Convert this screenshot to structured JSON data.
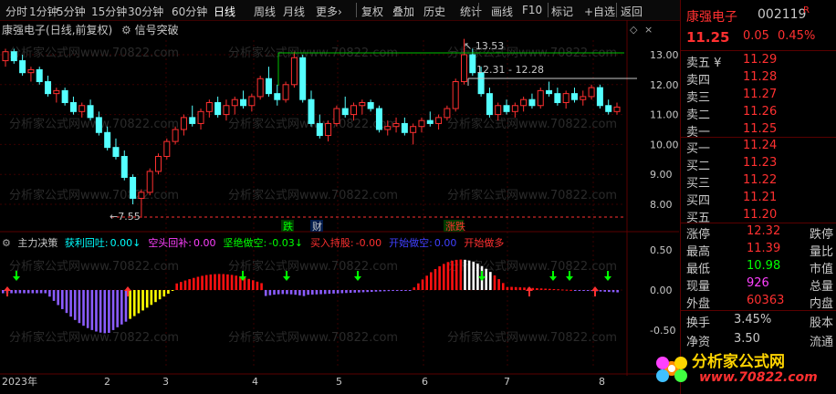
{
  "toolbar": {
    "items": [
      "分时",
      "1分钟",
      "5分钟",
      "15分钟",
      "30分钟",
      "60分钟",
      "日线",
      "周线",
      "月线",
      "更多›",
      "复权",
      "叠加",
      "历史",
      "统计",
      "画线",
      "F10",
      "标记",
      "+自选",
      "返回"
    ],
    "active": "日线"
  },
  "title": {
    "stock": "康强电子",
    "mode": "(日线,前复权)",
    "indicator": "信号突破"
  },
  "main_chart": {
    "y_ticks": [
      "13.00",
      "12.00",
      "11.00",
      "10.00",
      "9.00",
      "8.00"
    ],
    "high_label": "13.53",
    "low_label": "7.55",
    "range_label": "12.31 - 12.28",
    "annotations": [
      "跌",
      "财",
      "涨跌"
    ],
    "watermark": "分析家公式网www.70822.com"
  },
  "indicator": {
    "name": "主力决策",
    "items": [
      {
        "label": "获利回吐:",
        "value": "0.00↓",
        "color": "#00ffff"
      },
      {
        "label": "空头回补:",
        "value": "0.00",
        "color": "#ff40ff"
      },
      {
        "label": "坚绝做空:",
        "value": "-0.03↓",
        "color": "#00ff00"
      },
      {
        "label": "买入持股:",
        "value": "-0.00",
        "color": "#ff3030"
      },
      {
        "label": "开始做空:",
        "value": "0.00",
        "color": "#4040ff"
      },
      {
        "label": "开始做多",
        "value": "",
        "color": "#ff3030"
      }
    ],
    "y_ticks": [
      "0.50",
      "0.00",
      "-0.50"
    ]
  },
  "x_axis": {
    "labels": [
      "2023年",
      "2",
      "3",
      "4",
      "5",
      "6",
      "7",
      "8"
    ]
  },
  "quote": {
    "name": "康强电子",
    "code": "002119",
    "flag": "R",
    "price": "11.25",
    "change": "0.05",
    "pct": "0.45%",
    "asks": [
      {
        "label": "卖五 ¥",
        "price": "11.29"
      },
      {
        "label": "卖四",
        "price": "11.28"
      },
      {
        "label": "卖三",
        "price": "11.27"
      },
      {
        "label": "卖二",
        "price": "11.26"
      },
      {
        "label": "卖一",
        "price": "11.25"
      }
    ],
    "bids": [
      {
        "label": "买一",
        "price": "11.24"
      },
      {
        "label": "买二",
        "price": "11.23"
      },
      {
        "label": "买三",
        "price": "11.22"
      },
      {
        "label": "买四",
        "price": "11.21"
      },
      {
        "label": "买五",
        "price": "11.20"
      }
    ],
    "stats": [
      {
        "label": "涨停",
        "value": "12.32",
        "color": "#ff3030",
        "right": "跌停"
      },
      {
        "label": "最高",
        "value": "11.39",
        "color": "#ff3030",
        "right": "量比"
      },
      {
        "label": "最低",
        "value": "10.98",
        "color": "#00ff00",
        "right": "市值"
      },
      {
        "label": "现量",
        "value": "926",
        "color": "#ff40ff",
        "right": "总量"
      },
      {
        "label": "外盘",
        "value": "60363",
        "color": "#ff3030",
        "right": "内盘"
      },
      {
        "label": "换手",
        "value": "3.45%",
        "color": "#c8c8c8",
        "right": "股本"
      },
      {
        "label": "净资",
        "value": "3.50",
        "color": "#c8c8c8",
        "right": "流通"
      }
    ]
  },
  "logo": {
    "text": "分析家公式网",
    "url": "www.70822.com"
  },
  "candles": [
    [
      12.8,
      13.2,
      12.6,
      13.1
    ],
    [
      13.1,
      13.2,
      12.7,
      12.8
    ],
    [
      12.8,
      13.0,
      12.3,
      12.4
    ],
    [
      12.4,
      12.6,
      12.1,
      12.5
    ],
    [
      12.5,
      12.6,
      12.0,
      12.1
    ],
    [
      12.1,
      12.3,
      11.6,
      11.7
    ],
    [
      11.7,
      11.9,
      11.4,
      11.8
    ],
    [
      11.8,
      11.9,
      11.3,
      11.4
    ],
    [
      11.4,
      11.6,
      11.0,
      11.1
    ],
    [
      11.1,
      11.4,
      10.9,
      11.3
    ],
    [
      11.3,
      11.5,
      10.8,
      10.9
    ],
    [
      10.9,
      11.1,
      10.3,
      10.4
    ],
    [
      10.4,
      10.6,
      9.8,
      9.9
    ],
    [
      9.9,
      10.2,
      9.5,
      9.6
    ],
    [
      9.6,
      9.8,
      8.8,
      8.9
    ],
    [
      8.9,
      9.0,
      8.0,
      8.2
    ],
    [
      8.2,
      8.5,
      7.55,
      8.4
    ],
    [
      8.4,
      9.2,
      8.3,
      9.1
    ],
    [
      9.1,
      9.7,
      9.0,
      9.6
    ],
    [
      9.6,
      10.2,
      9.5,
      10.1
    ],
    [
      10.1,
      10.6,
      10.0,
      10.5
    ],
    [
      10.5,
      11.0,
      10.3,
      10.9
    ],
    [
      10.9,
      11.3,
      10.6,
      10.7
    ],
    [
      10.7,
      11.2,
      10.5,
      11.1
    ],
    [
      11.1,
      11.5,
      10.9,
      11.4
    ],
    [
      11.4,
      11.6,
      10.9,
      11.0
    ],
    [
      11.0,
      11.5,
      10.8,
      11.3
    ],
    [
      11.3,
      11.6,
      11.0,
      11.5
    ],
    [
      11.5,
      11.8,
      11.2,
      11.3
    ],
    [
      11.3,
      11.7,
      11.1,
      11.6
    ],
    [
      11.6,
      12.3,
      11.5,
      12.2
    ],
    [
      12.2,
      12.6,
      11.6,
      11.7
    ],
    [
      11.7,
      12.0,
      11.3,
      11.5
    ],
    [
      11.5,
      12.1,
      11.4,
      12.0
    ],
    [
      12.0,
      13.1,
      11.9,
      12.9
    ],
    [
      12.9,
      13.0,
      11.4,
      11.5
    ],
    [
      11.5,
      11.8,
      10.6,
      10.7
    ],
    [
      10.7,
      11.0,
      10.2,
      10.3
    ],
    [
      10.3,
      10.8,
      10.1,
      10.7
    ],
    [
      10.7,
      11.3,
      10.6,
      11.2
    ],
    [
      11.2,
      11.6,
      10.9,
      11.0
    ],
    [
      11.0,
      11.4,
      10.8,
      11.3
    ],
    [
      11.3,
      11.5,
      11.0,
      11.4
    ],
    [
      11.4,
      11.5,
      11.1,
      11.2
    ],
    [
      11.2,
      11.3,
      10.4,
      10.5
    ],
    [
      10.5,
      10.8,
      10.3,
      10.6
    ],
    [
      10.6,
      10.9,
      10.4,
      10.7
    ],
    [
      10.7,
      10.9,
      10.3,
      10.4
    ],
    [
      10.4,
      10.7,
      10.0,
      10.6
    ],
    [
      10.6,
      10.9,
      10.4,
      10.8
    ],
    [
      10.8,
      11.1,
      10.6,
      10.7
    ],
    [
      10.7,
      11.0,
      10.5,
      10.9
    ],
    [
      10.9,
      11.3,
      10.8,
      11.2
    ],
    [
      11.2,
      12.2,
      11.1,
      12.1
    ],
    [
      12.1,
      13.53,
      12.0,
      13.0
    ],
    [
      13.0,
      13.2,
      12.3,
      12.4
    ],
    [
      12.4,
      12.6,
      11.6,
      11.7
    ],
    [
      11.7,
      11.9,
      10.9,
      11.0
    ],
    [
      11.0,
      11.4,
      10.8,
      11.3
    ],
    [
      11.3,
      11.5,
      11.0,
      11.1
    ],
    [
      11.1,
      11.4,
      10.9,
      11.3
    ],
    [
      11.3,
      11.6,
      11.1,
      11.5
    ],
    [
      11.5,
      11.7,
      11.2,
      11.3
    ],
    [
      11.3,
      11.9,
      11.2,
      11.8
    ],
    [
      11.8,
      12.1,
      11.6,
      11.7
    ],
    [
      11.7,
      11.9,
      11.3,
      11.4
    ],
    [
      11.4,
      11.8,
      11.2,
      11.7
    ],
    [
      11.7,
      11.9,
      11.4,
      11.5
    ],
    [
      11.5,
      11.8,
      11.3,
      11.6
    ],
    [
      11.6,
      12.0,
      11.5,
      11.9
    ],
    [
      11.9,
      12.0,
      11.2,
      11.3
    ],
    [
      11.3,
      11.5,
      11.0,
      11.1
    ],
    [
      11.1,
      11.4,
      11.0,
      11.25
    ]
  ]
}
